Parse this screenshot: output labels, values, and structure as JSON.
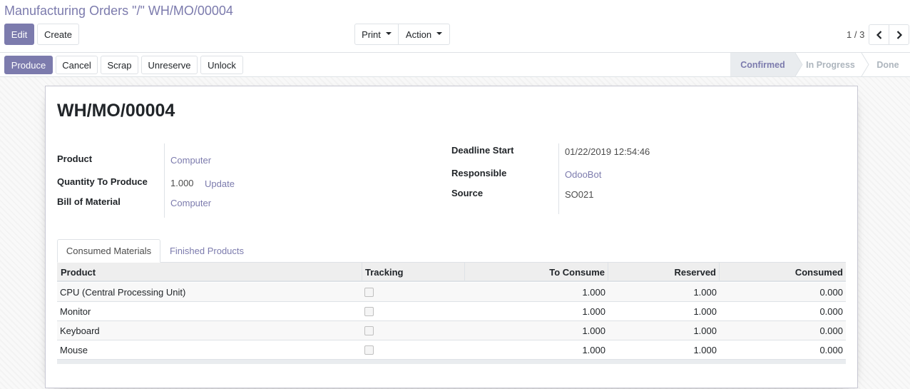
{
  "breadcrumb": "Manufacturing Orders \"/\" WH/MO/00004",
  "toolbar": {
    "edit_label": "Edit",
    "create_label": "Create",
    "print_label": "Print",
    "action_label": "Action"
  },
  "pager": {
    "value": "1 / 3"
  },
  "statusbar": {
    "buttons": [
      "Produce",
      "Cancel",
      "Scrap",
      "Unreserve",
      "Unlock"
    ],
    "stages": [
      "Confirmed",
      "In Progress",
      "Done"
    ],
    "active_stage": "Confirmed"
  },
  "form": {
    "title": "WH/MO/00004",
    "product_label": "Product",
    "product_value": "Computer",
    "qty_label": "Quantity To Produce",
    "qty_value": "1.000",
    "qty_update": "Update",
    "bom_label": "Bill of Material",
    "bom_value": "Computer",
    "deadline_label": "Deadline Start",
    "deadline_value": "01/22/2019 12:54:46",
    "responsible_label": "Responsible",
    "responsible_value": "OdooBot",
    "source_label": "Source",
    "source_value": "SO021"
  },
  "tabs": [
    "Consumed Materials",
    "Finished Products"
  ],
  "table": {
    "headers": [
      "Product",
      "Tracking",
      "To Consume",
      "Reserved",
      "Consumed"
    ],
    "rows": [
      {
        "product": "CPU (Central Processing Unit)",
        "to_consume": "1.000",
        "reserved": "1.000",
        "consumed": "0.000"
      },
      {
        "product": "Monitor",
        "to_consume": "1.000",
        "reserved": "1.000",
        "consumed": "0.000"
      },
      {
        "product": "Keyboard",
        "to_consume": "1.000",
        "reserved": "1.000",
        "consumed": "0.000"
      },
      {
        "product": "Mouse",
        "to_consume": "1.000",
        "reserved": "1.000",
        "consumed": "0.000"
      }
    ]
  },
  "colors": {
    "primary": "#7c7bad",
    "border": "#dee2e6"
  },
  "icons": {
    "pager_prev": "chevron-left-icon",
    "pager_next": "chevron-right-icon",
    "dropdown": "caret-down-icon"
  }
}
